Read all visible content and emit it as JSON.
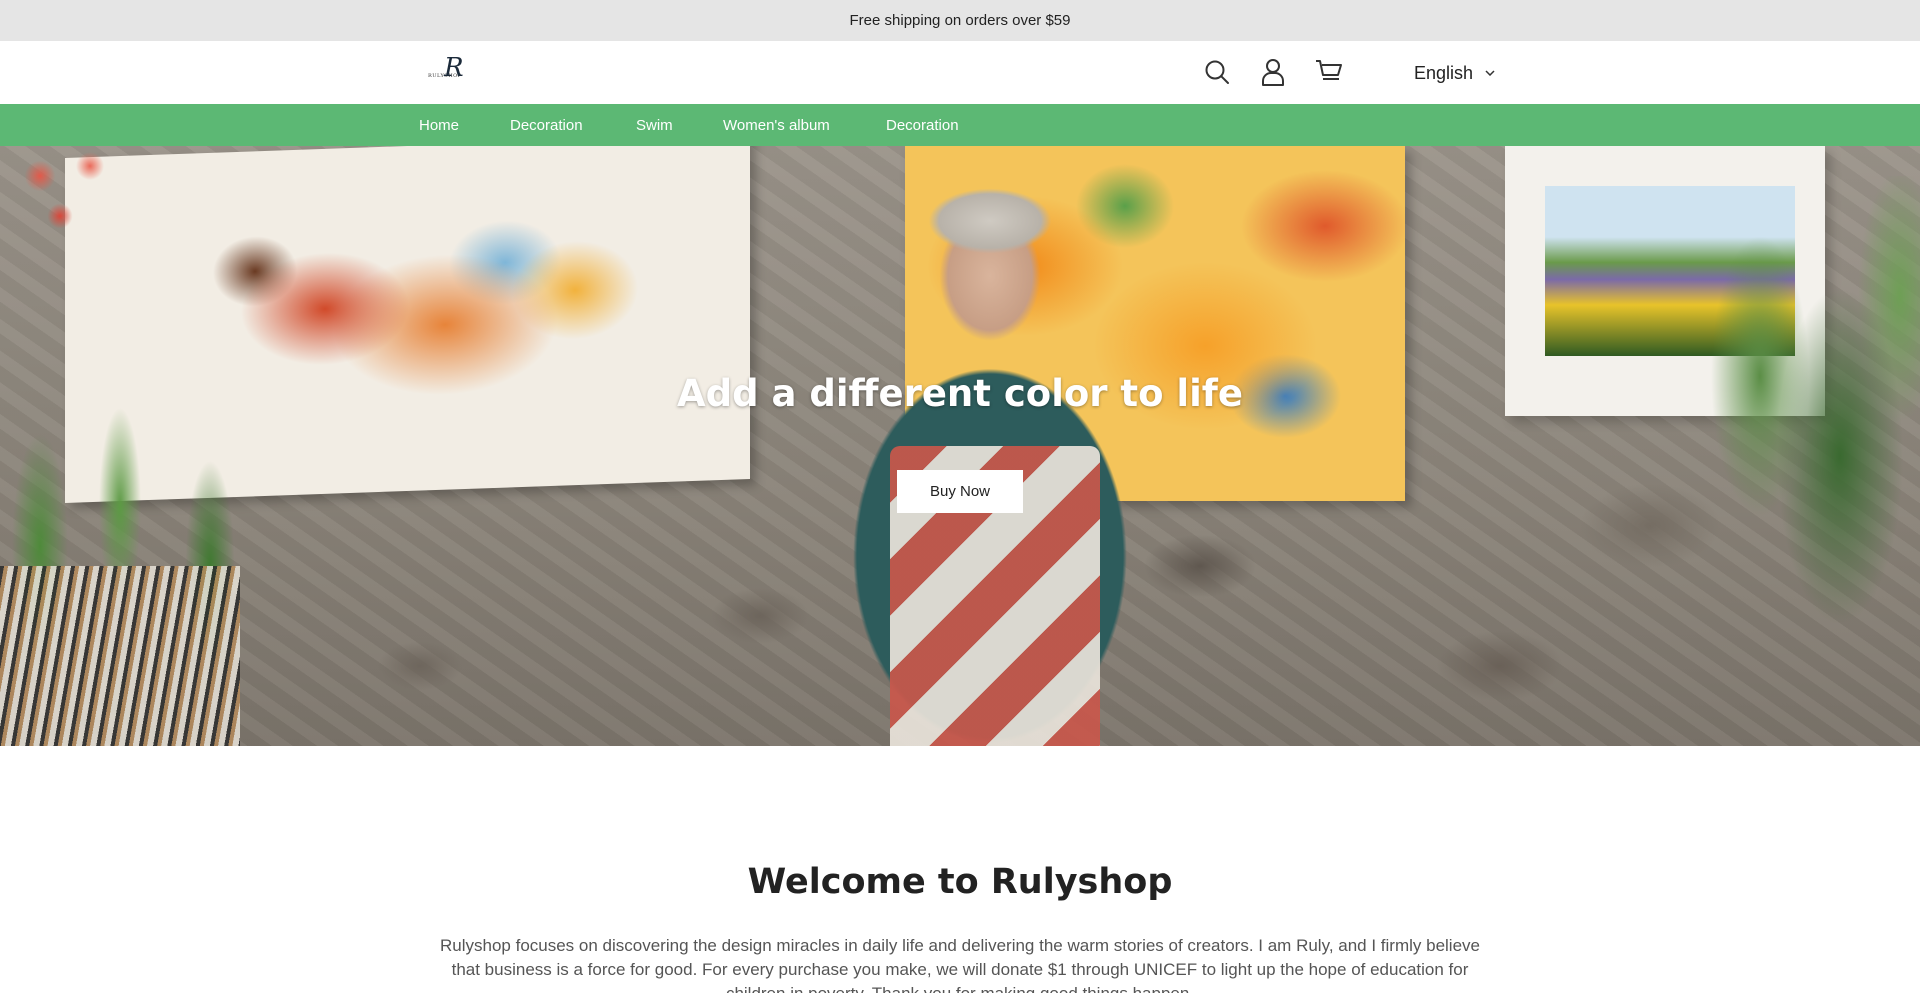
{
  "announcement": "Free shipping on orders over $59",
  "header": {
    "logo_small_text": "RULYSHOP",
    "logo_letter": "R",
    "icons": [
      "search-icon",
      "account-icon",
      "cart-icon"
    ],
    "language": "English"
  },
  "nav": {
    "items": [
      {
        "label": "Home"
      },
      {
        "label": "Decoration"
      },
      {
        "label": "Swim"
      },
      {
        "label": "Women's album"
      },
      {
        "label": "Decoration"
      }
    ],
    "background_color": "#5cb874"
  },
  "hero": {
    "title": "Add a different color to life",
    "button_label": "Buy Now"
  },
  "welcome": {
    "title": "Welcome to Rulyshop",
    "text": "Rulyshop focuses on discovering the design miracles in daily life and delivering the warm stories of creators. I am Ruly, and I firmly believe that business is a force for good. For every purchase you make, we will donate $1 through UNICEF to light up the hope of education for children in poverty. Thank you for making good things happen."
  }
}
